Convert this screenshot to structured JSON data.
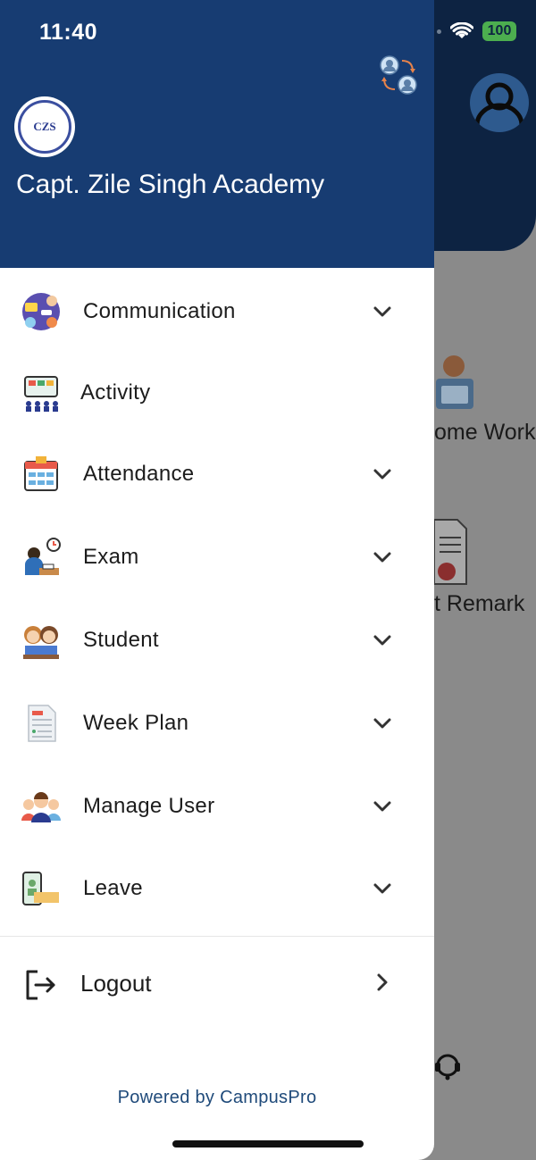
{
  "status_bar": {
    "time": "11:40",
    "battery": "100"
  },
  "drawer": {
    "school_name": "Capt. Zile Singh Academy",
    "logo_text": "CZS",
    "menu": [
      {
        "label": "Communication",
        "icon": "communication-icon",
        "expandable": true
      },
      {
        "label": "Activity",
        "icon": "activity-icon",
        "expandable": false
      },
      {
        "label": "Attendance",
        "icon": "attendance-icon",
        "expandable": true
      },
      {
        "label": "Exam",
        "icon": "exam-icon",
        "expandable": true
      },
      {
        "label": "Student",
        "icon": "student-icon",
        "expandable": true
      },
      {
        "label": "Week Plan",
        "icon": "week-plan-icon",
        "expandable": true
      },
      {
        "label": "Manage User",
        "icon": "manage-user-icon",
        "expandable": true
      },
      {
        "label": "Leave",
        "icon": "leave-icon",
        "expandable": true
      }
    ],
    "logout_label": "Logout",
    "powered_by": "Powered by CampusPro"
  },
  "background": {
    "tiles": [
      "ome Work",
      "t Remark"
    ]
  },
  "colors": {
    "drawer_header": "#173c72",
    "app_header": "#0d2342",
    "accent_text": "#1f4a7a"
  }
}
